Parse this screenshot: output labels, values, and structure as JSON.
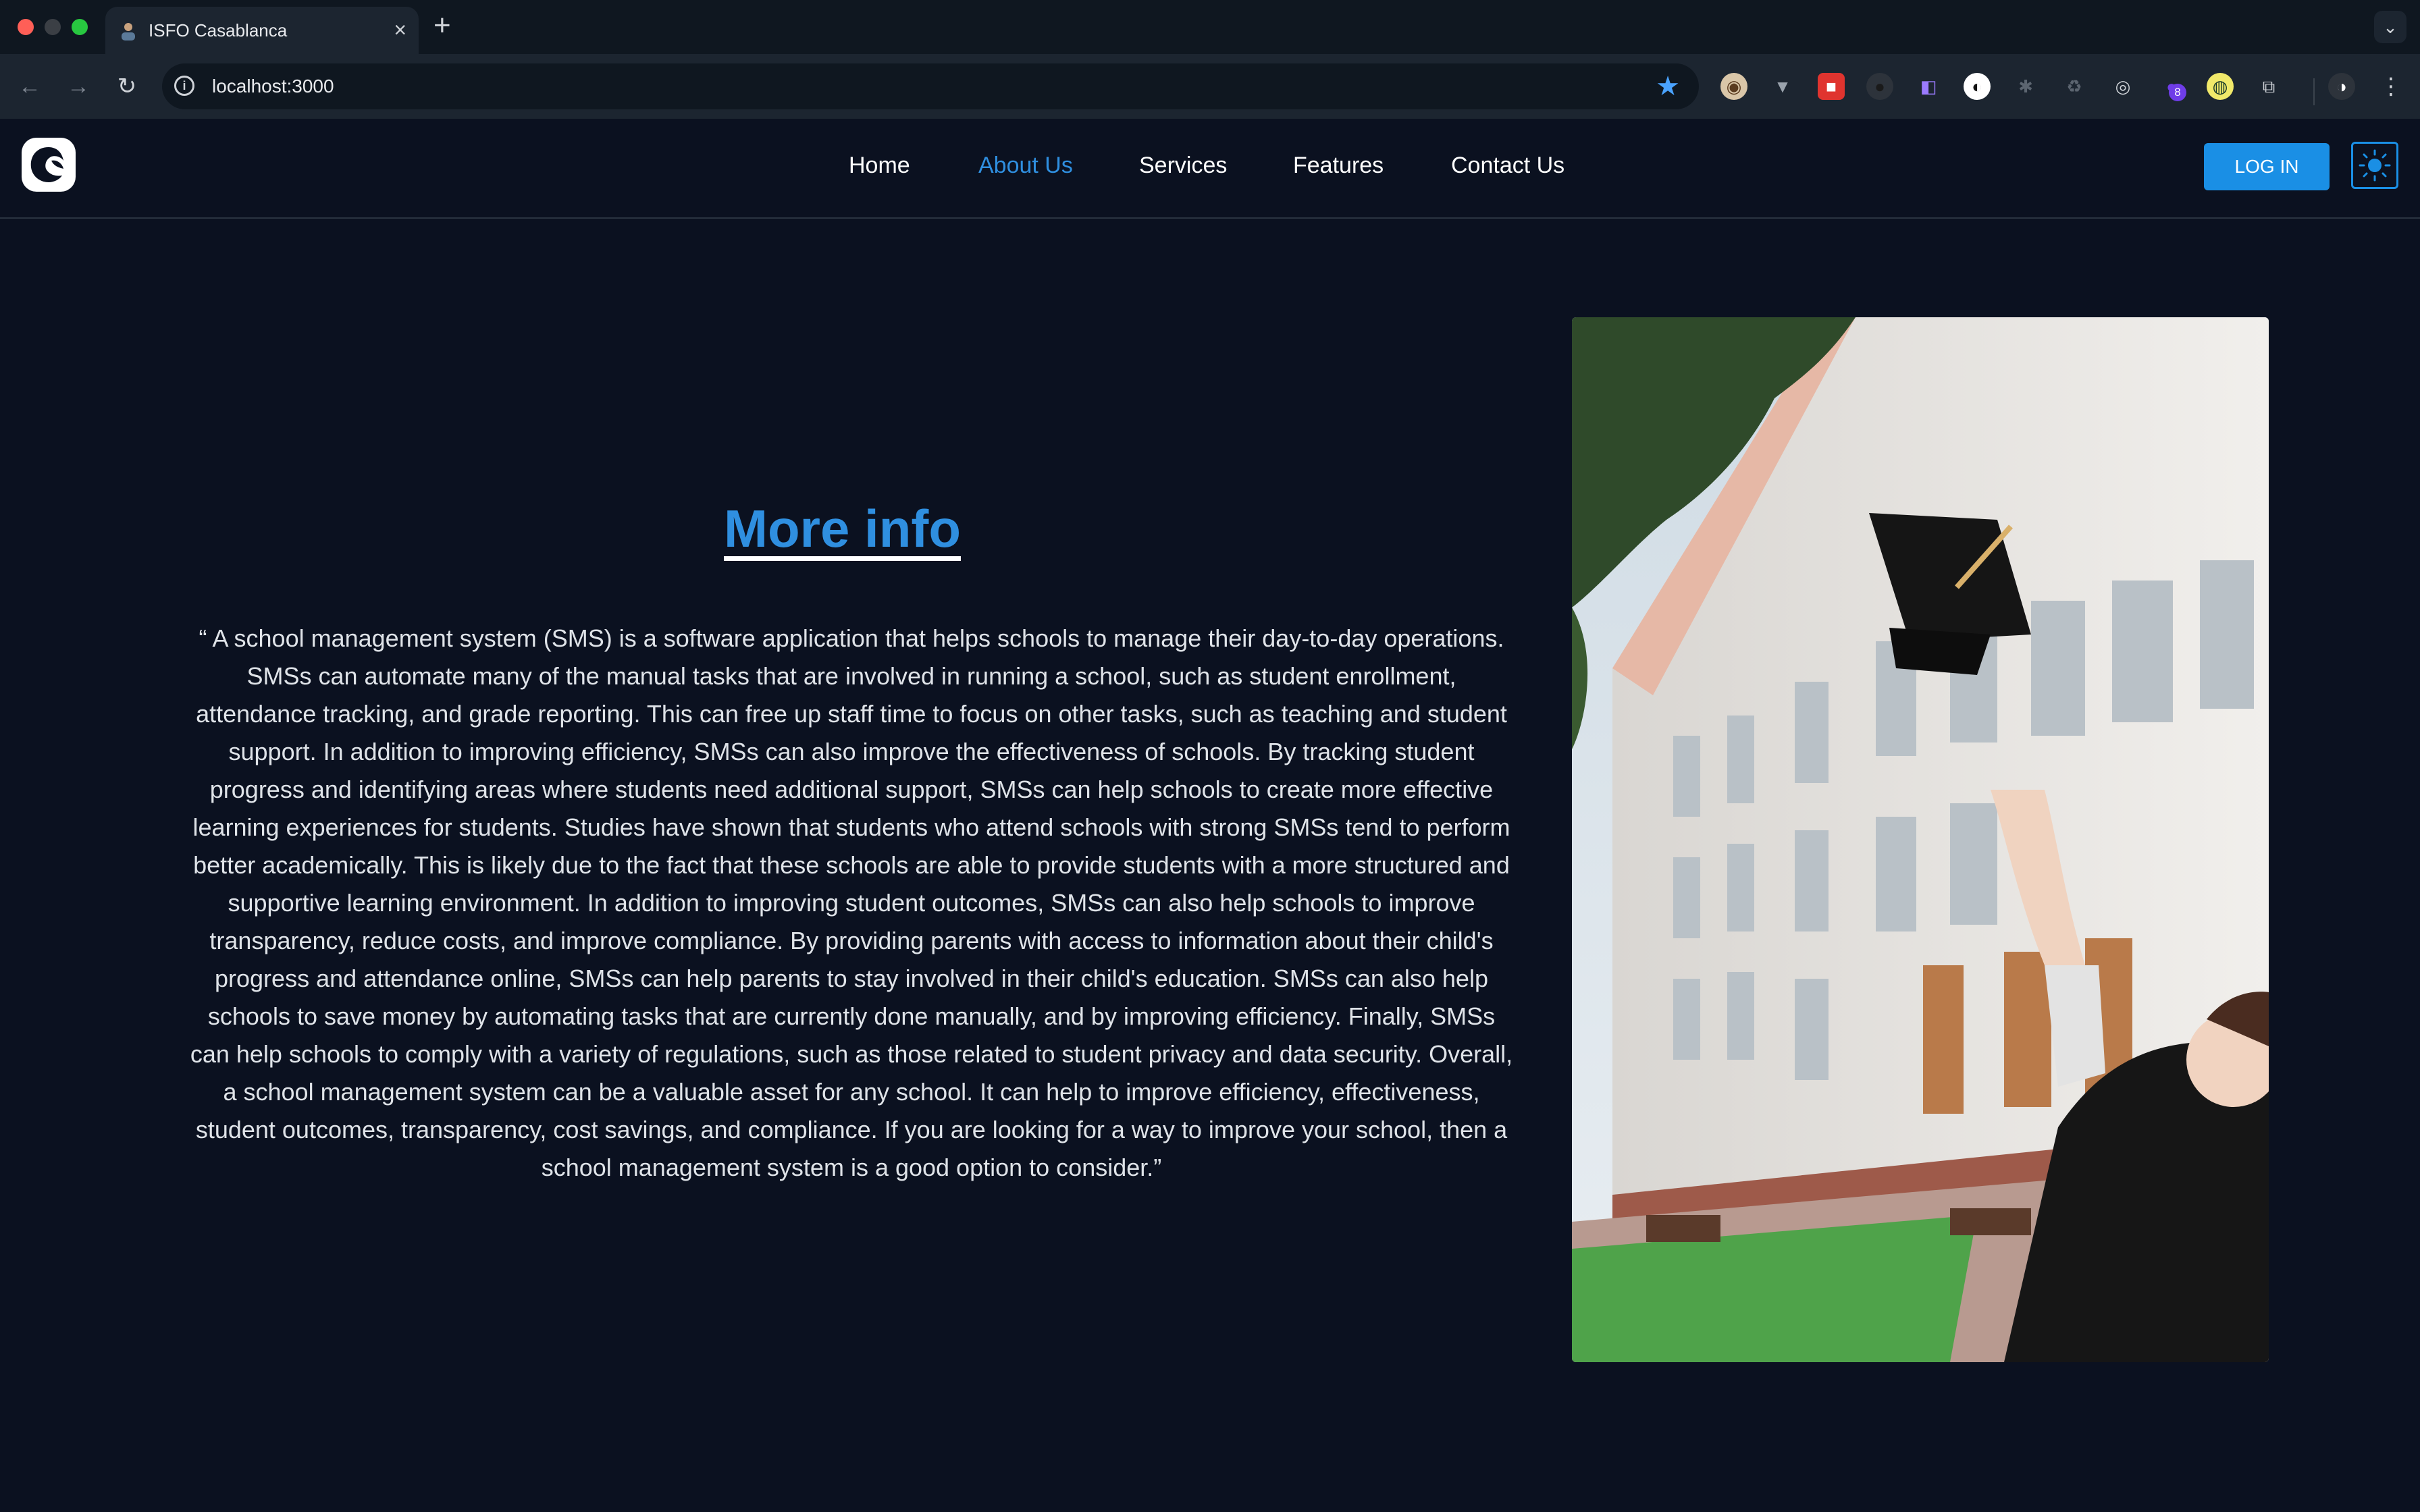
{
  "browser": {
    "tab_title": "ISFO Casablanca",
    "new_tab": "+",
    "close": "×",
    "url": "localhost:3000",
    "extension_badge": "8",
    "icons": [
      "back-arrow-icon",
      "forward-arrow-icon",
      "reload-icon",
      "site-info-icon",
      "bookmark-star-icon",
      "extensions-puzzle-icon",
      "profile-avatar-icon",
      "kebab-menu-icon"
    ]
  },
  "header": {
    "nav": [
      {
        "label": "Home",
        "active": false
      },
      {
        "label": "About Us",
        "active": true
      },
      {
        "label": "Services",
        "active": false
      },
      {
        "label": "Features",
        "active": false
      },
      {
        "label": "Contact Us",
        "active": false
      }
    ],
    "login_label": "LOG IN",
    "theme_toggle_icon": "sun-icon"
  },
  "main": {
    "heading": "More info",
    "quote": "“ A school management system (SMS) is a software application that helps schools to manage their day-to-day operations. SMSs can automate many of the manual tasks that are involved in running a school, such as student enrollment, attendance tracking, and grade reporting. This can free up staff time to focus on other tasks, such as teaching and student support. In addition to improving efficiency, SMSs can also improve the effectiveness of schools. By tracking student progress and identifying areas where students need additional support, SMSs can help schools to create more effective learning experiences for students. Studies have shown that students who attend schools with strong SMSs tend to perform better academically. This is likely due to the fact that these schools are able to provide students with a more structured and supportive learning environment. In addition to improving student outcomes, SMSs can also help schools to improve transparency, reduce costs, and improve compliance. By providing parents with access to information about their child's progress and attendance online, SMSs can help parents to stay involved in their child's education. SMSs can also help schools to save money by automating tasks that are currently done manually, and by improving efficiency. Finally, SMSs can help schools to comply with a variety of regulations, such as those related to student privacy and data security. Overall, a school management system can be a valuable asset for any school. It can help to improve efficiency, effectiveness, student outcomes, transparency, cost savings, and compliance. If you are looking for a way to improve your school, then a school management system is a good option to consider.”"
  },
  "colors": {
    "page_bg": "#0b1120",
    "accent": "#1a8fe5",
    "active_link": "#2f8fe0"
  }
}
